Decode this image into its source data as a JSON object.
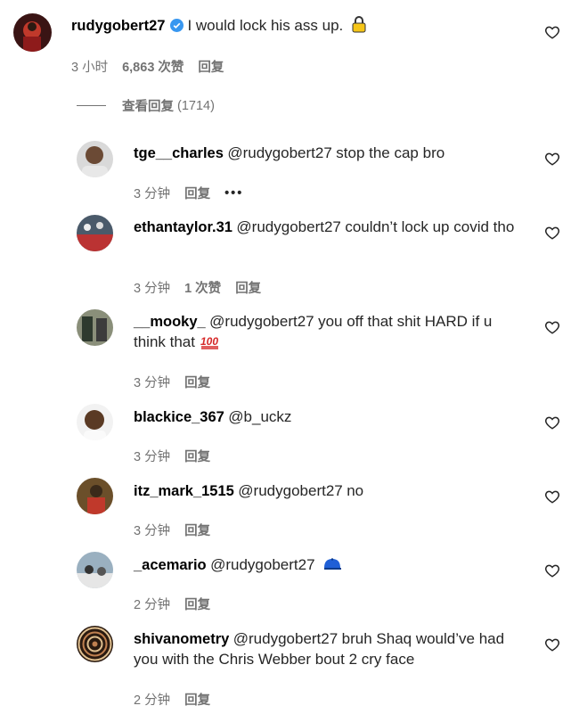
{
  "main_comment": {
    "username": "rudygobert27",
    "text": "I would lock his ass up.",
    "emoji": "lock-emoji",
    "time": "3 小时",
    "likes": "6,863 次赞",
    "reply_label": "回复"
  },
  "view_replies": {
    "label": "查看回复",
    "count": "(1714)"
  },
  "replies": [
    {
      "username": "tge__charles",
      "mention": "@rudygobert27",
      "text": "stop the cap bro",
      "emoji": "",
      "time": "3 分钟",
      "likes": "",
      "reply_label": "回复",
      "more": "•••"
    },
    {
      "username": "ethantaylor.31",
      "mention": "@rudygobert27",
      "text": "couldn’t lock up covid tho",
      "emoji": "",
      "time": "3 分钟",
      "likes": "1 次赞",
      "reply_label": "回复",
      "more": ""
    },
    {
      "username": "__mooky_",
      "mention": "@rudygobert27",
      "text": "you off that shit HARD if u think that",
      "emoji": "hundred-points-emoji",
      "time": "3 分钟",
      "likes": "",
      "reply_label": "回复",
      "more": ""
    },
    {
      "username": "blackice_367",
      "mention": "@b_uckz",
      "text": "",
      "emoji": "",
      "time": "3 分钟",
      "likes": "",
      "reply_label": "回复",
      "more": ""
    },
    {
      "username": "itz_mark_1515",
      "mention": "@rudygobert27",
      "text": "no",
      "emoji": "",
      "time": "3 分钟",
      "likes": "",
      "reply_label": "回复",
      "more": ""
    },
    {
      "username": "_acemario",
      "mention": "@rudygobert27",
      "text": "",
      "emoji": "blue-cap-emoji",
      "time": "2 分钟",
      "likes": "",
      "reply_label": "回复",
      "more": ""
    },
    {
      "username": "shivanometry",
      "mention": "@rudygobert27",
      "text": "bruh Shaq would’ve had you with the Chris Webber bout 2 cry face",
      "emoji": "",
      "time": "2 分钟",
      "likes": "",
      "reply_label": "回复",
      "more": ""
    }
  ],
  "colors": {
    "mention": "#00376b",
    "meta": "#737373",
    "verified": "#3897f0"
  }
}
